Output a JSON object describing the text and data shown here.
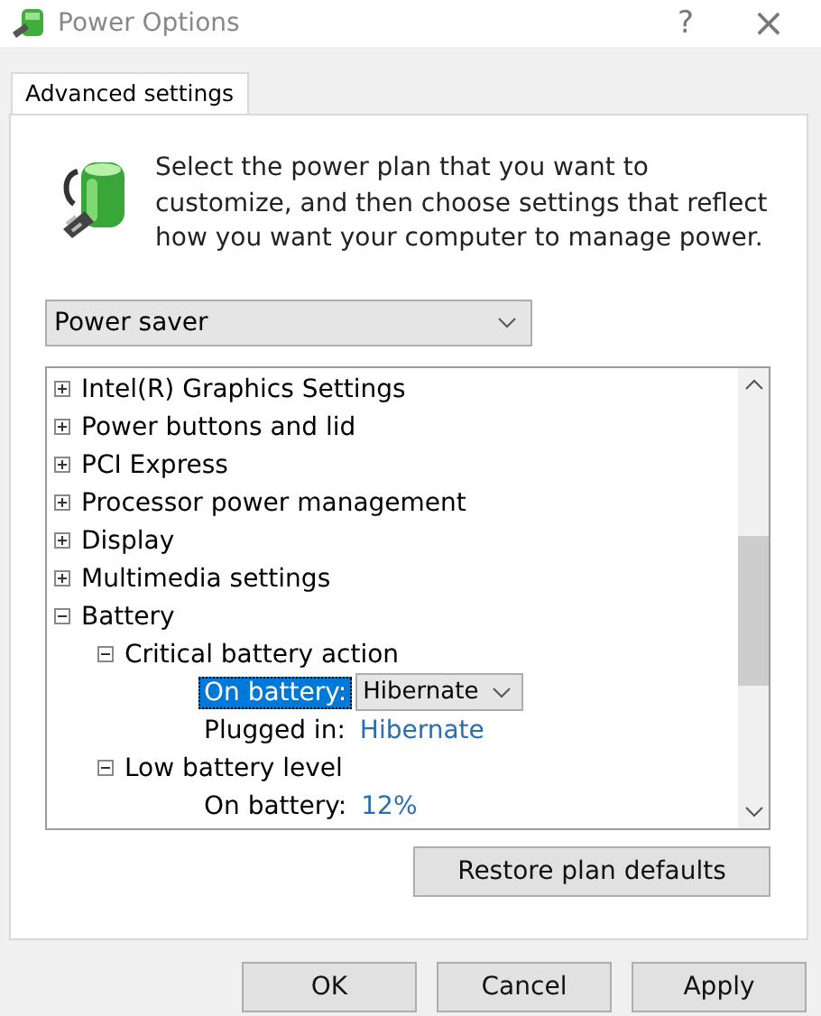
{
  "window": {
    "title": "Power Options",
    "help": "?",
    "close": "×"
  },
  "tabs": [
    {
      "label": "Advanced settings",
      "selected": true
    }
  ],
  "intro": "Select the power plan that you want to customize, and then choose settings that reflect how you want your computer to manage power.",
  "plan": {
    "value": "Power saver"
  },
  "tree": [
    {
      "label": "Intel(R) Graphics Settings",
      "expanded": false
    },
    {
      "label": "Power buttons and lid",
      "expanded": false
    },
    {
      "label": "PCI Express",
      "expanded": false
    },
    {
      "label": "Processor power management",
      "expanded": false
    },
    {
      "label": "Display",
      "expanded": false
    },
    {
      "label": "Multimedia settings",
      "expanded": false
    },
    {
      "label": "Battery",
      "expanded": true,
      "children": [
        {
          "label": "Critical battery action",
          "expanded": true,
          "children": [
            {
              "kind": "setting",
              "label": "On battery:",
              "value": "Hibernate",
              "selected": true
            },
            {
              "kind": "setting",
              "label": "Plugged in:",
              "value": "Hibernate",
              "selected": false
            }
          ]
        },
        {
          "label": "Low battery level",
          "expanded": true,
          "children": [
            {
              "kind": "setting",
              "label": "On battery:",
              "value": "12%",
              "selected": false
            }
          ]
        }
      ]
    }
  ],
  "restore_button": "Restore plan defaults",
  "buttons": [
    "OK",
    "Cancel",
    "Apply"
  ]
}
